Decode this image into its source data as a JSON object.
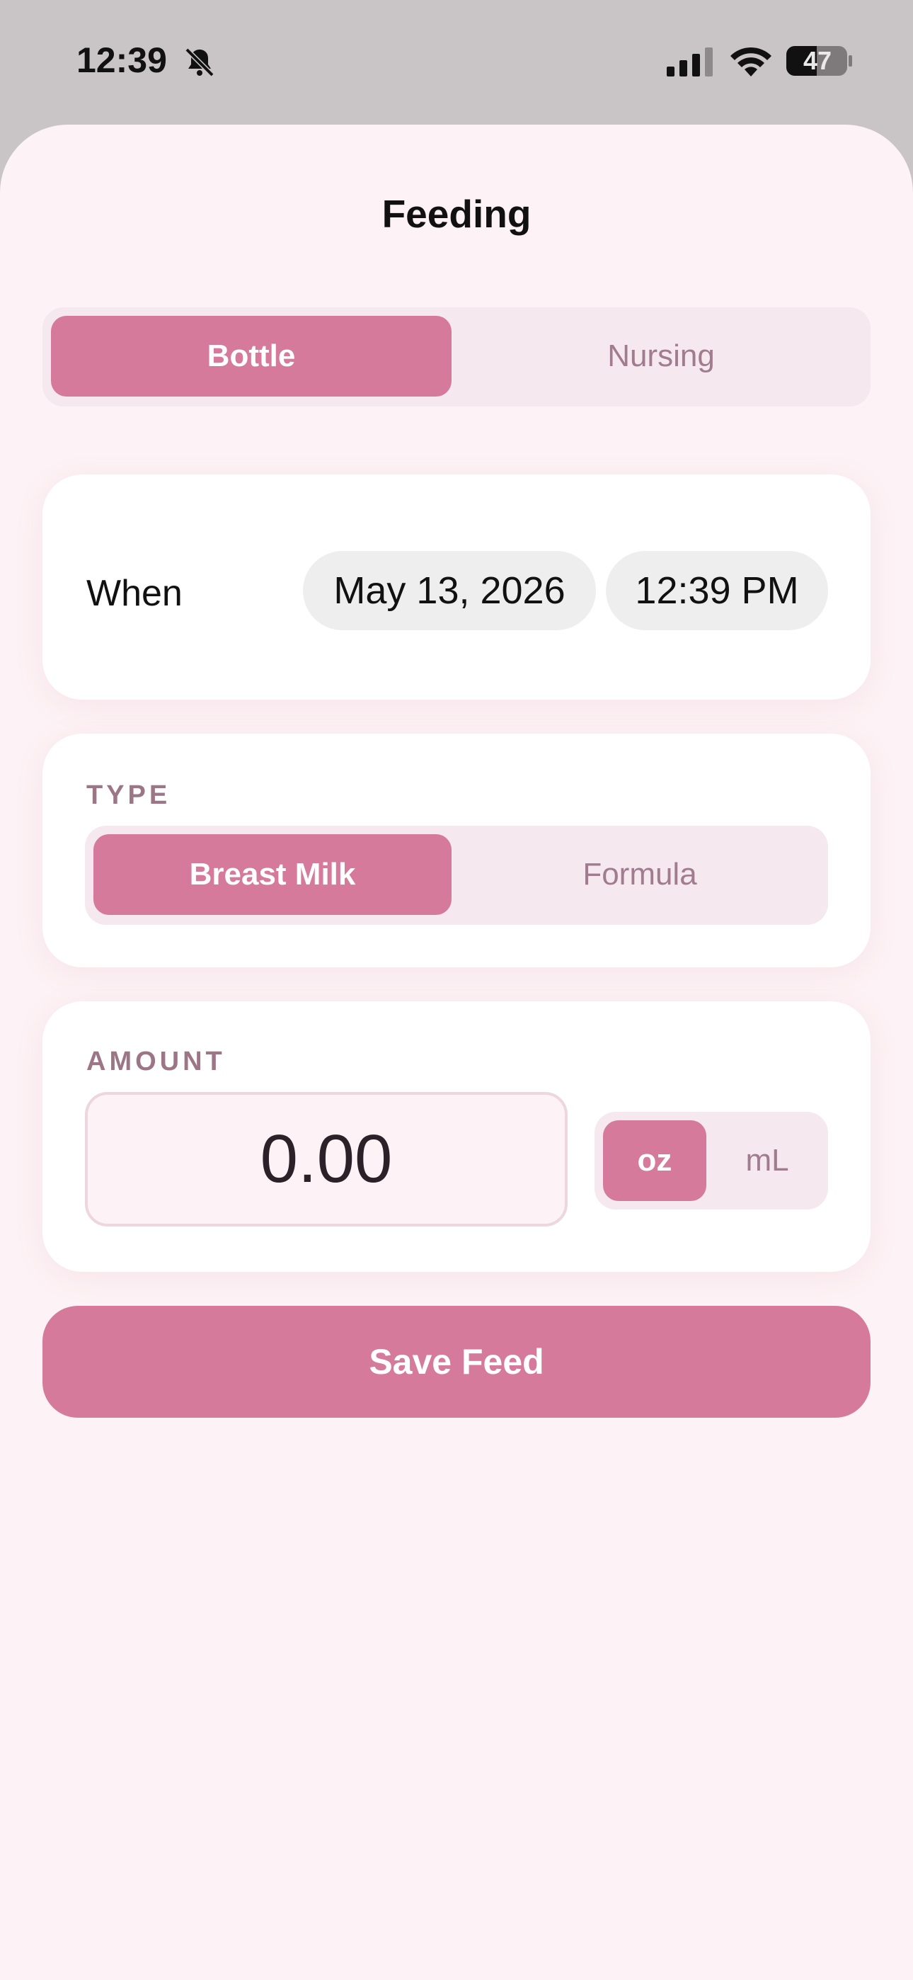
{
  "status_bar": {
    "time": "12:39",
    "battery": "47"
  },
  "sheet": {
    "title": "Feeding"
  },
  "mode_toggle": {
    "options": [
      "Bottle",
      "Nursing"
    ],
    "selected": "Bottle"
  },
  "when": {
    "label": "When",
    "date": "May 13, 2026",
    "time": "12:39 PM"
  },
  "type": {
    "label": "TYPE",
    "options": [
      "Breast Milk",
      "Formula"
    ],
    "selected": "Breast Milk"
  },
  "amount": {
    "label": "AMOUNT",
    "value": "0.00",
    "units": [
      "oz",
      "mL"
    ],
    "selected_unit": "oz"
  },
  "save": {
    "label": "Save Feed"
  },
  "colors": {
    "accent": "#d57a9a",
    "sheet_background": "#fdf2f5",
    "segment_background": "#f5e8ee",
    "label_muted": "#9c7686"
  }
}
